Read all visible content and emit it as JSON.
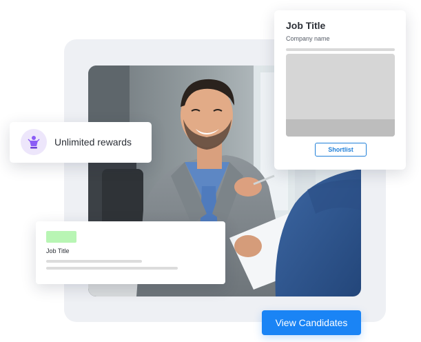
{
  "job_card": {
    "title": "Job Title",
    "company": "Company name",
    "shortlist_label": "Shortlist",
    "accent_color": "#1f7fd8"
  },
  "rewards_card": {
    "label": "Unlimited rewards",
    "icon": "reward-emblem-icon",
    "badge_color": "#ede6fb",
    "icon_color": "#8b5cf6"
  },
  "small_job_card": {
    "title": "Job Title",
    "tag_color": "#b8f5b4"
  },
  "cta": {
    "label": "View Candidates",
    "color": "#1a84f5"
  },
  "photo": {
    "description_icon": "office-meeting-photo"
  }
}
